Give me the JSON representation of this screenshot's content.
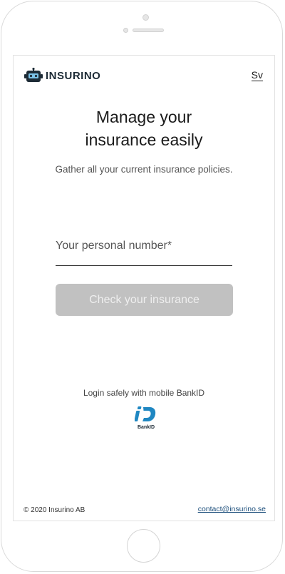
{
  "header": {
    "brand": "INSURINO",
    "language_label": "Sv"
  },
  "hero": {
    "title": "Manage your insurance easily",
    "subtitle": "Gather all your current insurance policies."
  },
  "form": {
    "personal_number_placeholder": "Your personal number*",
    "personal_number_value": "",
    "check_button_label": "Check your insurance"
  },
  "bankid": {
    "prompt": "Login safely with mobile BankID",
    "logo_text": "BankID"
  },
  "footer": {
    "copyright": "© 2020 Insurino AB",
    "contact_email": "contact@insurino.se"
  },
  "colors": {
    "brand_dark": "#1d2b36",
    "button_disabled": "#c1c1c1",
    "link": "#1d4f7c",
    "bankid_blue": "#1f87c2"
  },
  "icons": {
    "logo": "robot-icon",
    "bankid": "bankid-icon"
  }
}
